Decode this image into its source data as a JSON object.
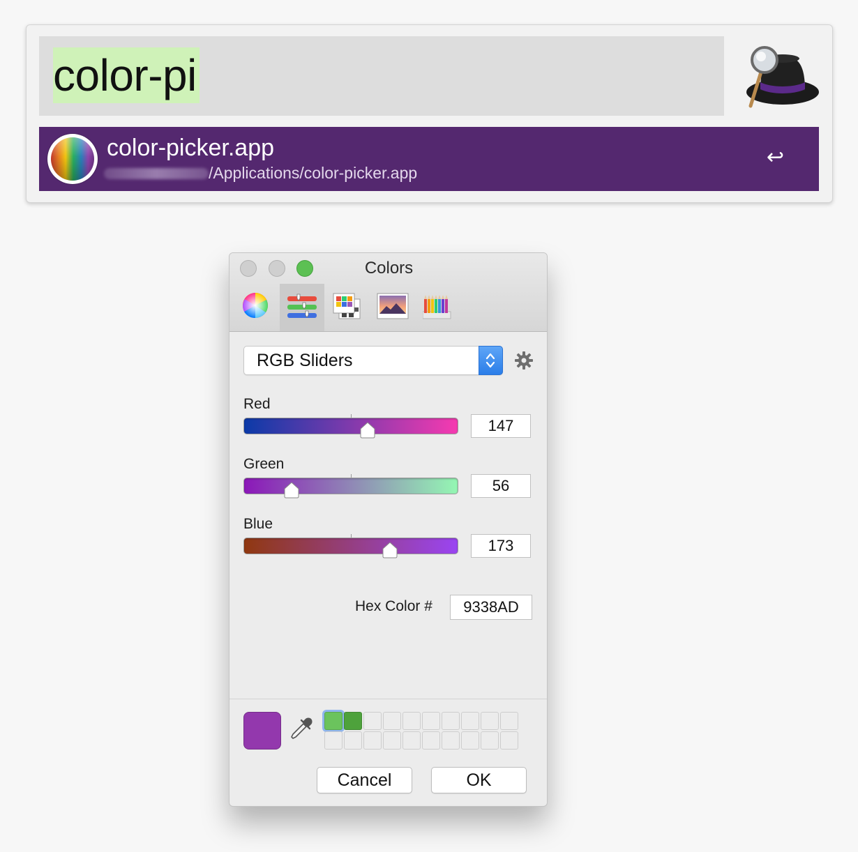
{
  "alfred": {
    "query": "color-pi",
    "result": {
      "title": "color-picker.app",
      "path": "/Applications/color-picker.app",
      "return_symbol": "↩"
    },
    "colors": {
      "result_bg": "#54286f",
      "query_highlight": "#cff2b8"
    }
  },
  "colors_panel": {
    "title": "Colors",
    "tabs": [
      {
        "icon": "color-wheel-icon",
        "active": false
      },
      {
        "icon": "color-sliders-icon",
        "active": true
      },
      {
        "icon": "color-palettes-icon",
        "active": false
      },
      {
        "icon": "image-palettes-icon",
        "active": false
      },
      {
        "icon": "pencils-icon",
        "active": false
      }
    ],
    "mode": "RGB Sliders",
    "sliders": [
      {
        "label": "Red",
        "value": "147",
        "level": 0.576,
        "gradient": [
          "#0b3aa8",
          "#f63ab0"
        ]
      },
      {
        "label": "Green",
        "value": "56",
        "level": 0.22,
        "gradient": [
          "#8b17b8",
          "#94f7b3"
        ]
      },
      {
        "label": "Blue",
        "value": "173",
        "level": 0.678,
        "gradient": [
          "#903810",
          "#9a45f2"
        ]
      }
    ],
    "hex_label": "Hex Color #",
    "hex_value": "9338AD",
    "current_color": "#9338ad",
    "swatches": [
      "#6bc35d",
      "#4ea23c"
    ],
    "cancel_label": "Cancel",
    "ok_label": "OK"
  }
}
